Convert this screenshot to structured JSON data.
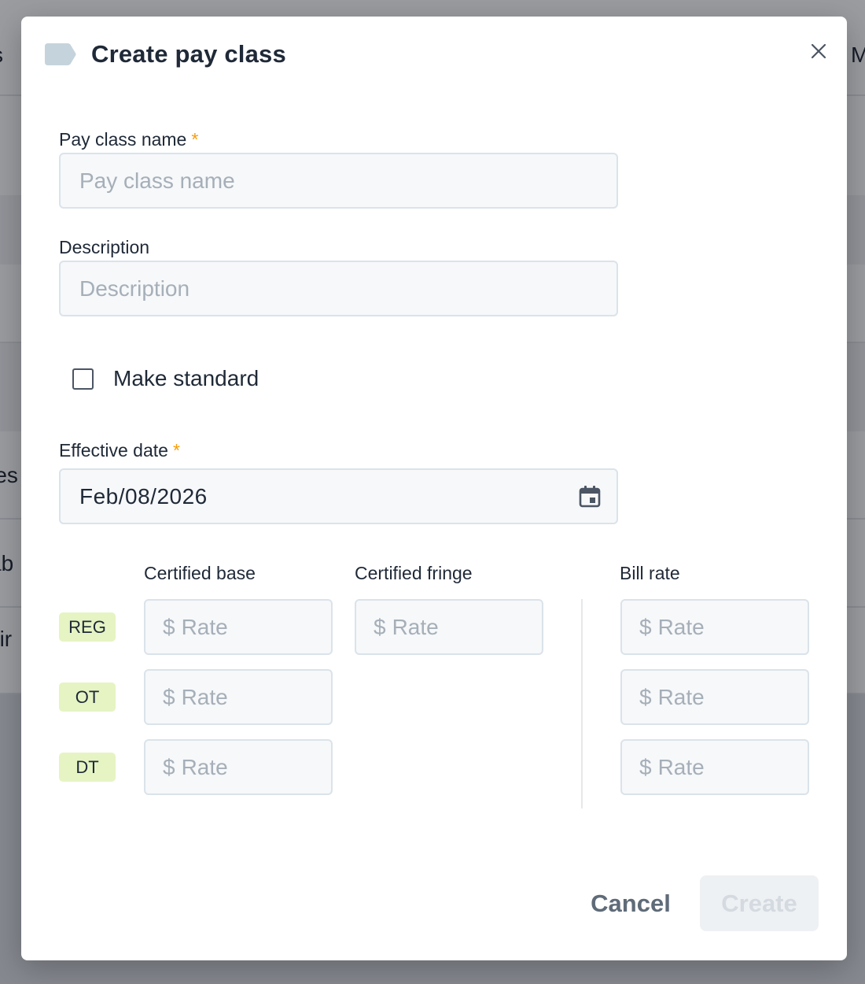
{
  "background": {
    "texts": [
      "s",
      "M",
      "res",
      "ab",
      "bir"
    ]
  },
  "modal": {
    "title": "Create pay class",
    "icons": {
      "title": "tag-icon",
      "close": "close-icon",
      "date": "calendar-icon"
    },
    "pay_class_name": {
      "label": "Pay class name",
      "required_mark": "*",
      "placeholder": "Pay class name",
      "value": ""
    },
    "description": {
      "label": "Description",
      "placeholder": "Description",
      "value": ""
    },
    "make_standard": {
      "label": "Make standard",
      "checked": false
    },
    "effective_date": {
      "label": "Effective date",
      "required_mark": "*",
      "value": "Feb/08/2026"
    },
    "rates": {
      "columns": [
        "Certified base",
        "Certified fringe",
        "Bill rate"
      ],
      "currency_symbol": "$",
      "placeholder": "Rate",
      "rows": [
        {
          "badge": "REG",
          "fields": [
            "Certified base",
            "Certified fringe",
            "Bill rate"
          ]
        },
        {
          "badge": "OT",
          "fields": [
            "Certified base",
            "Bill rate"
          ]
        },
        {
          "badge": "DT",
          "fields": [
            "Certified base",
            "Bill rate"
          ]
        }
      ]
    },
    "buttons": {
      "cancel": "Cancel",
      "create": "Create",
      "create_enabled": false
    }
  },
  "colors": {
    "accent_required": "#f59e0b",
    "badge_bg": "#e6f4c4",
    "input_bg": "#f6f8fa",
    "input_border": "#dbe3ea",
    "placeholder": "#a6afb8",
    "cancel_text": "#5f6b78",
    "create_disabled_bg": "#eef1f4"
  }
}
